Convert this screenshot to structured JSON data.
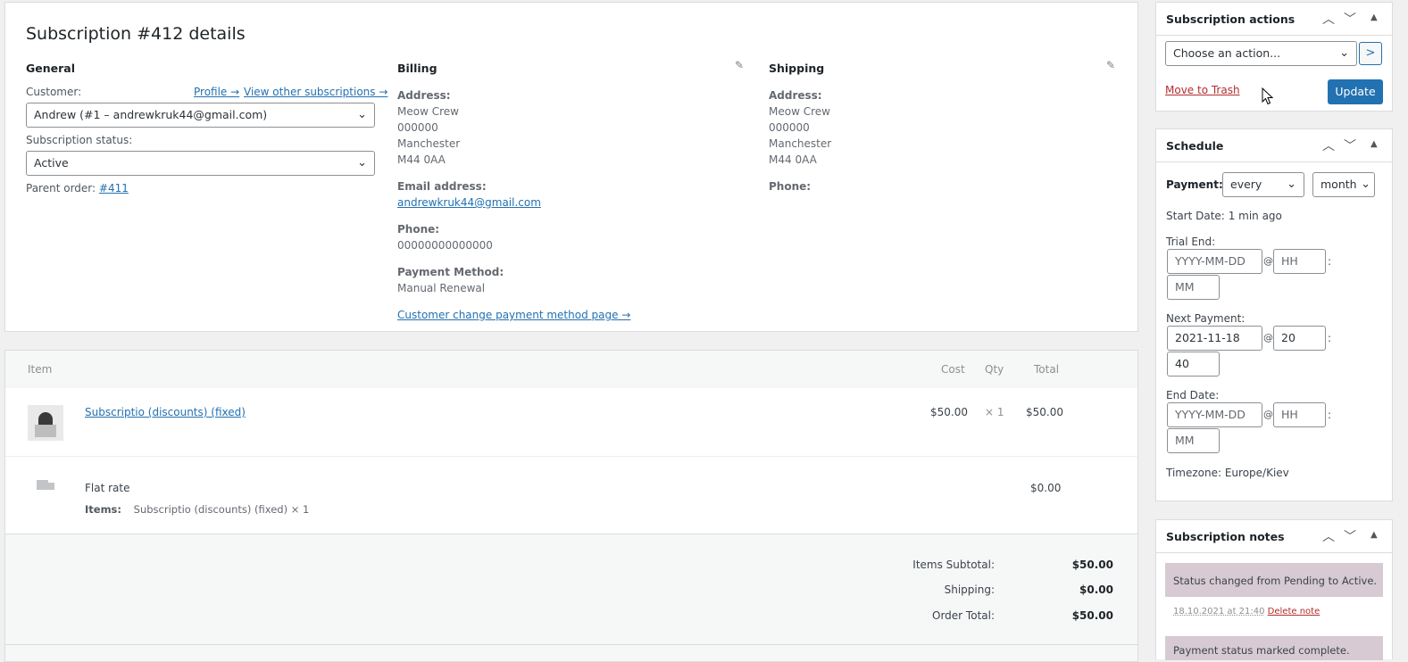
{
  "details": {
    "title": "Subscription #412 details",
    "general": {
      "heading": "General",
      "customer_label": "Customer:",
      "profile_link": "Profile →",
      "other_subs_link": "View other subscriptions →",
      "customer_value": "Andrew (#1 – andrewkruk44@gmail.com)",
      "status_label": "Subscription status:",
      "status_value": "Active",
      "parent_label": "Parent order:",
      "parent_link": "#411"
    },
    "billing": {
      "heading": "Billing",
      "address_label": "Address:",
      "address_lines": [
        "Meow Crew",
        "000000",
        "Manchester",
        "M44 0AA"
      ],
      "email_label": "Email address:",
      "email_value": "andrewkruk44@gmail.com",
      "phone_label": "Phone:",
      "phone_value": "00000000000000",
      "payment_label": "Payment Method:",
      "payment_value": "Manual Renewal",
      "change_payment_link": "Customer change payment method page →"
    },
    "shipping": {
      "heading": "Shipping",
      "address_label": "Address:",
      "address_lines": [
        "Meow Crew",
        "000000",
        "Manchester",
        "M44 0AA"
      ],
      "phone_label": "Phone:"
    }
  },
  "items": {
    "headers": {
      "item": "Item",
      "cost": "Cost",
      "qty": "Qty",
      "total": "Total"
    },
    "product": {
      "name": "Subscriptio (discounts) (fixed)",
      "cost": "$50.00",
      "qty": "× 1",
      "total": "$50.00"
    },
    "shipping": {
      "name": "Flat rate",
      "items_label": "Items:",
      "items_value": "Subscriptio (discounts) (fixed) × 1",
      "total": "$0.00"
    },
    "totals": [
      {
        "label": "Items Subtotal:",
        "value": "$50.00"
      },
      {
        "label": "Shipping:",
        "value": "$0.00"
      },
      {
        "label": "Order Total:",
        "value": "$50.00"
      }
    ]
  },
  "actions": {
    "title": "Subscription actions",
    "select_value": "Choose an action...",
    "go_label": ">",
    "trash_link": "Move to Trash",
    "update_label": "Update"
  },
  "schedule": {
    "title": "Schedule",
    "payment_label": "Payment:",
    "interval_value": "every",
    "period_value": "month",
    "start_label": "Start Date:",
    "start_value": "1 min ago",
    "trial_label": "Trial End:",
    "next_label": "Next Payment:",
    "end_label": "End Date:",
    "date_placeholder": "YYYY-MM-DD",
    "hour_placeholder": "HH",
    "minute_placeholder": "MM",
    "next_date": "2021-11-18",
    "next_hour": "20",
    "next_minute": "40",
    "at": "@",
    "colon": ":",
    "timezone": "Timezone: Europe/Kiev"
  },
  "notes": {
    "title": "Subscription notes",
    "note1_text": "Status changed from Pending to Active.",
    "note1_meta": "18.10.2021 at 21:40",
    "note1_delete": "Delete note",
    "note2_text": "Payment status marked complete."
  },
  "colors": {
    "accent": "#2271b1",
    "trash": "#b32d2e",
    "note_bg": "#d7cad2"
  }
}
